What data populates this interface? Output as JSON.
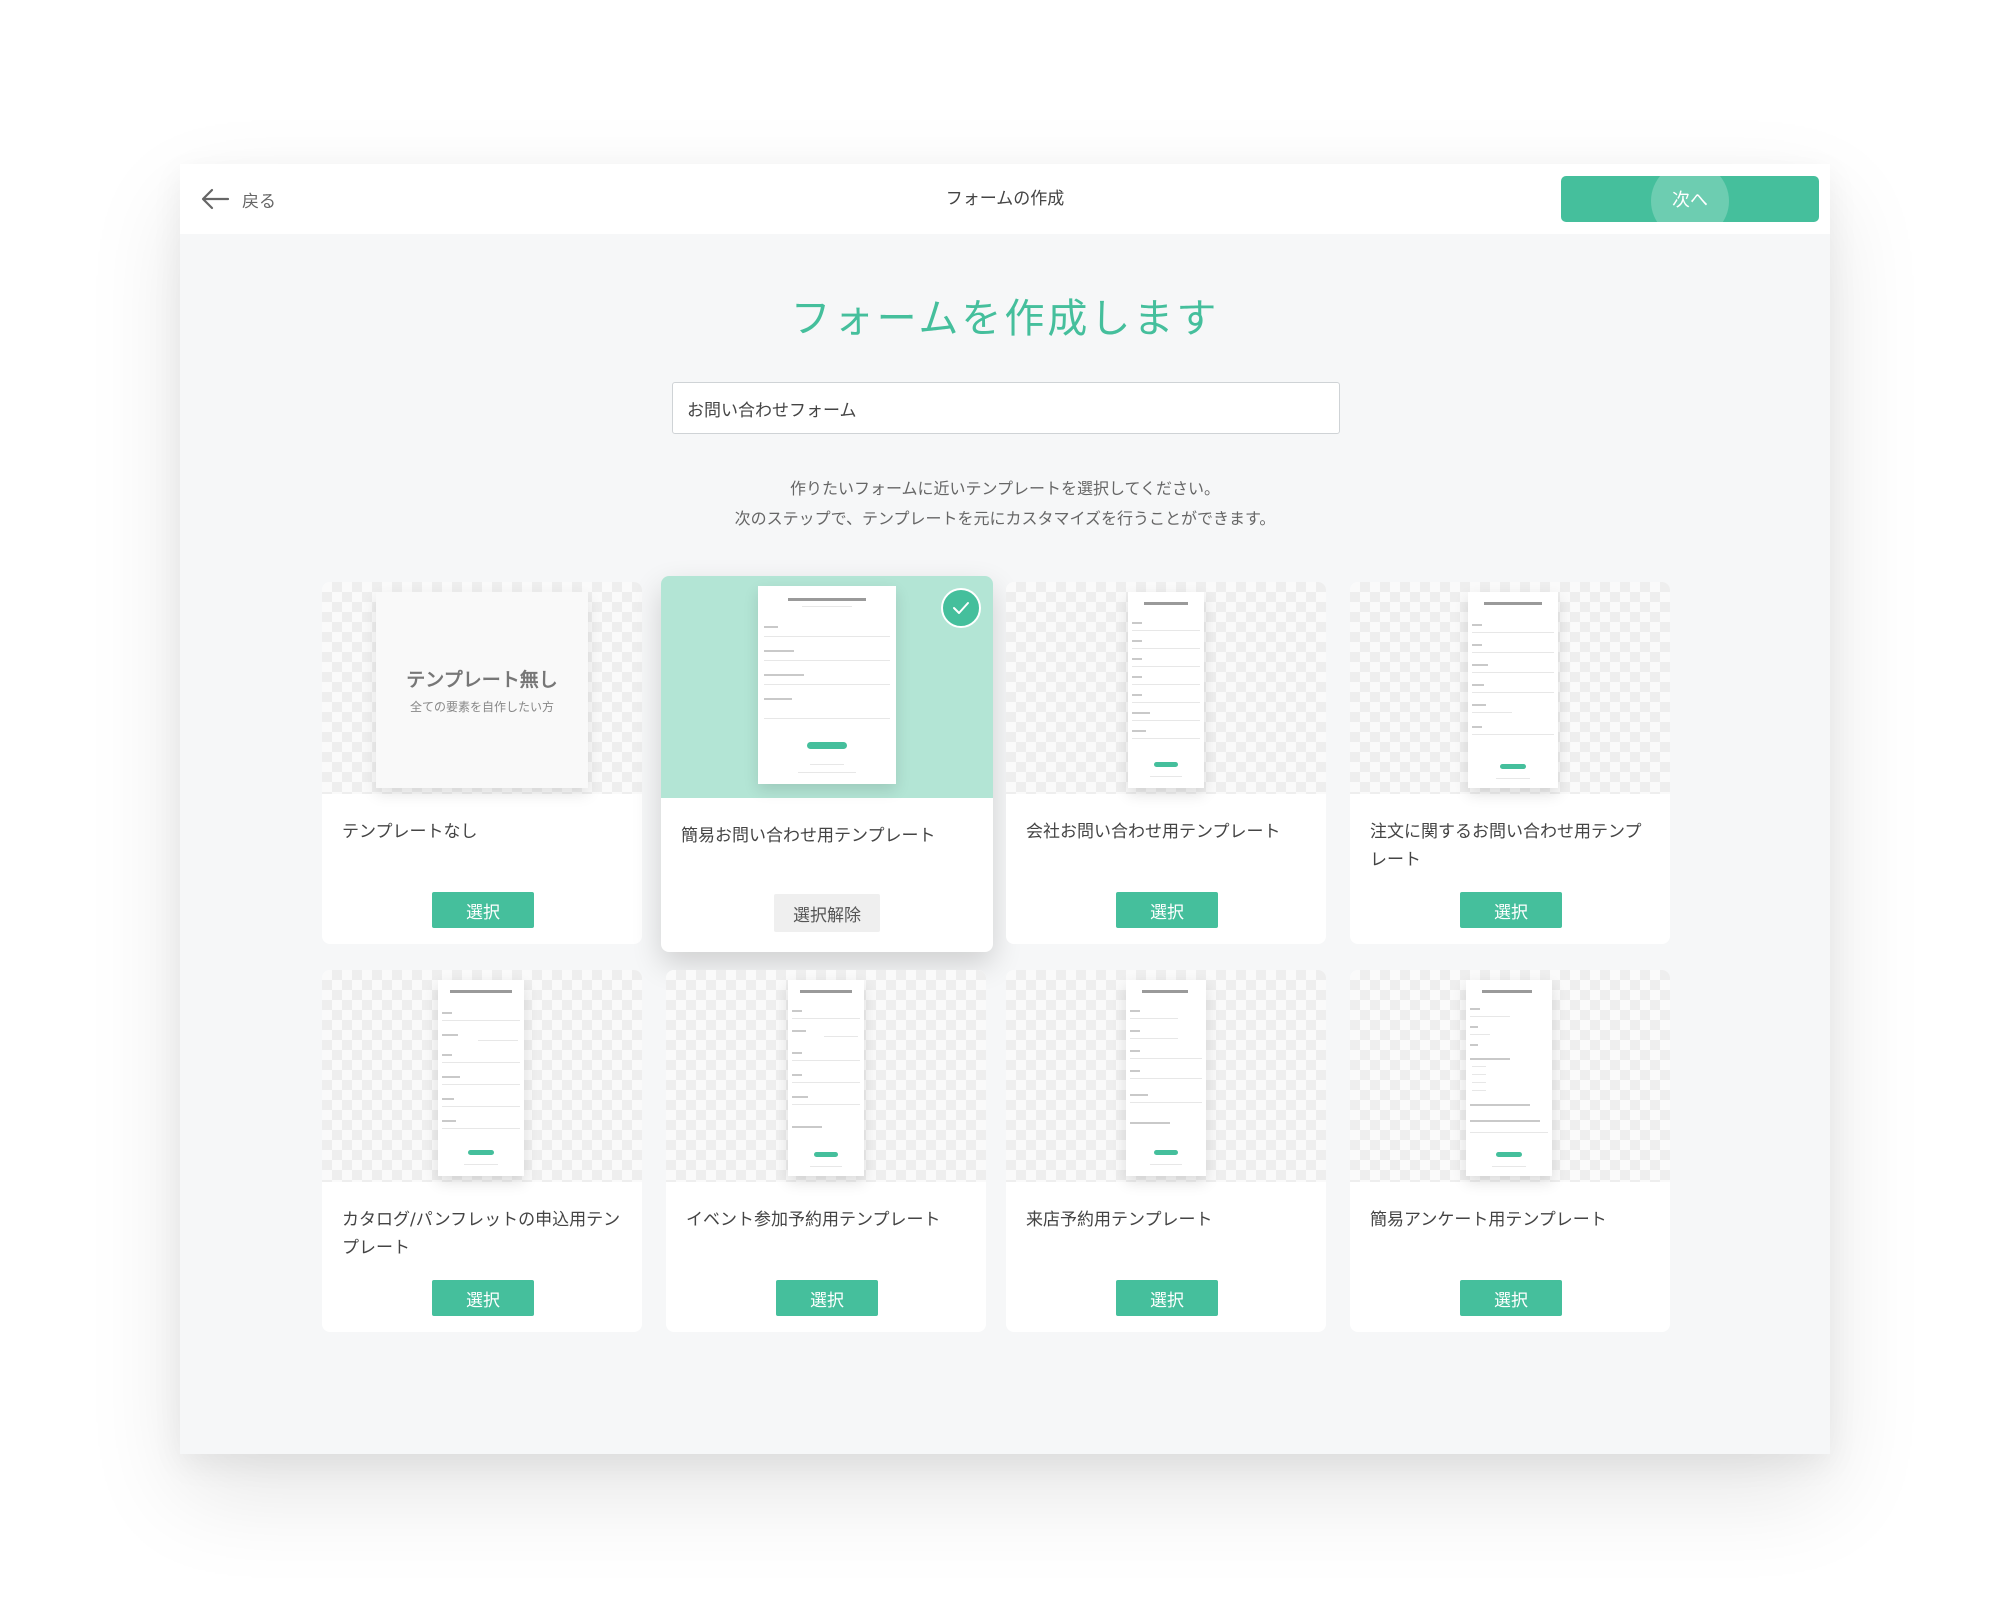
{
  "header": {
    "back_label": "戻る",
    "title": "フォームの作成",
    "next_label": "次へ"
  },
  "main": {
    "title": "フォームを作成します",
    "form_name_value": "お問い合わせフォーム",
    "description_line1": "作りたいフォームに近いテンプレートを選択してください。",
    "description_line2": "次のステップで、テンプレートを元にカスタマイズを行うことができます。"
  },
  "templates": [
    {
      "name": "テンプレートなし",
      "button": "選択",
      "selected": false,
      "blank_title": "テンプレート無し",
      "blank_subtitle": "全ての要素を自作したい方"
    },
    {
      "name": "簡易お問い合わせ用テンプレート",
      "button": "選択解除",
      "selected": true
    },
    {
      "name": "会社お問い合わせ用テンプレート",
      "button": "選択",
      "selected": false
    },
    {
      "name": "注文に関するお問い合わせ用テンプレート",
      "button": "選択",
      "selected": false
    },
    {
      "name": "カタログ/パンフレットの申込用テンプレート",
      "button": "選択",
      "selected": false
    },
    {
      "name": "イベント参加予約用テンプレート",
      "button": "選択",
      "selected": false
    },
    {
      "name": "来店予約用テンプレート",
      "button": "選択",
      "selected": false
    },
    {
      "name": "簡易アンケート用テンプレート",
      "button": "選択",
      "selected": false
    }
  ],
  "colors": {
    "accent": "#45bf9c",
    "selected_thumb_bg": "#b3e5d5",
    "page_bg": "#f6f7f8"
  }
}
